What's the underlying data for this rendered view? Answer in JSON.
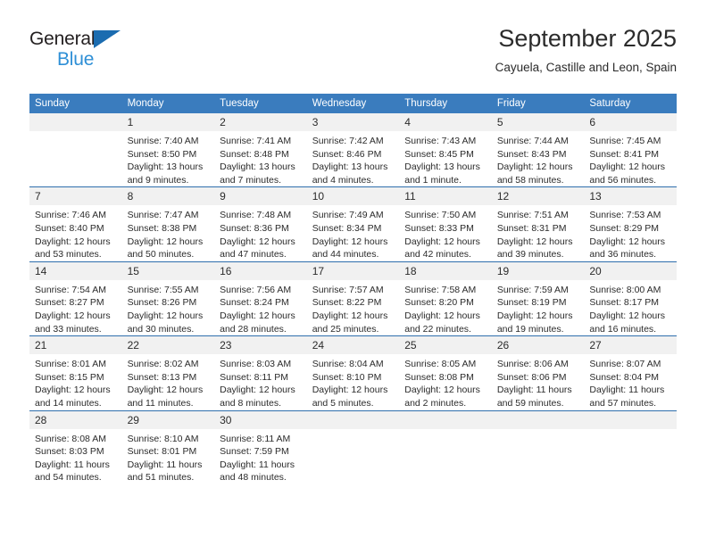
{
  "brand": {
    "name_part1": "General",
    "name_part2": "Blue",
    "triangle_color": "#1b6cb0",
    "blue_text_color": "#2e8fd6"
  },
  "header": {
    "title": "September 2025",
    "subtitle": "Cayuela, Castille and Leon, Spain"
  },
  "theme": {
    "header_row_bg": "#3a7cbe",
    "week_divider": "#2f6fad",
    "daynum_bg": "#f1f1f1",
    "text": "#2b2b2b"
  },
  "calendar": {
    "weekday_headers": [
      "Sunday",
      "Monday",
      "Tuesday",
      "Wednesday",
      "Thursday",
      "Friday",
      "Saturday"
    ],
    "weeks": [
      [
        {
          "day": "",
          "lines": []
        },
        {
          "day": "1",
          "lines": [
            "Sunrise: 7:40 AM",
            "Sunset: 8:50 PM",
            "Daylight: 13 hours",
            "and 9 minutes."
          ]
        },
        {
          "day": "2",
          "lines": [
            "Sunrise: 7:41 AM",
            "Sunset: 8:48 PM",
            "Daylight: 13 hours",
            "and 7 minutes."
          ]
        },
        {
          "day": "3",
          "lines": [
            "Sunrise: 7:42 AM",
            "Sunset: 8:46 PM",
            "Daylight: 13 hours",
            "and 4 minutes."
          ]
        },
        {
          "day": "4",
          "lines": [
            "Sunrise: 7:43 AM",
            "Sunset: 8:45 PM",
            "Daylight: 13 hours",
            "and 1 minute."
          ]
        },
        {
          "day": "5",
          "lines": [
            "Sunrise: 7:44 AM",
            "Sunset: 8:43 PM",
            "Daylight: 12 hours",
            "and 58 minutes."
          ]
        },
        {
          "day": "6",
          "lines": [
            "Sunrise: 7:45 AM",
            "Sunset: 8:41 PM",
            "Daylight: 12 hours",
            "and 56 minutes."
          ]
        }
      ],
      [
        {
          "day": "7",
          "lines": [
            "Sunrise: 7:46 AM",
            "Sunset: 8:40 PM",
            "Daylight: 12 hours",
            "and 53 minutes."
          ]
        },
        {
          "day": "8",
          "lines": [
            "Sunrise: 7:47 AM",
            "Sunset: 8:38 PM",
            "Daylight: 12 hours",
            "and 50 minutes."
          ]
        },
        {
          "day": "9",
          "lines": [
            "Sunrise: 7:48 AM",
            "Sunset: 8:36 PM",
            "Daylight: 12 hours",
            "and 47 minutes."
          ]
        },
        {
          "day": "10",
          "lines": [
            "Sunrise: 7:49 AM",
            "Sunset: 8:34 PM",
            "Daylight: 12 hours",
            "and 44 minutes."
          ]
        },
        {
          "day": "11",
          "lines": [
            "Sunrise: 7:50 AM",
            "Sunset: 8:33 PM",
            "Daylight: 12 hours",
            "and 42 minutes."
          ]
        },
        {
          "day": "12",
          "lines": [
            "Sunrise: 7:51 AM",
            "Sunset: 8:31 PM",
            "Daylight: 12 hours",
            "and 39 minutes."
          ]
        },
        {
          "day": "13",
          "lines": [
            "Sunrise: 7:53 AM",
            "Sunset: 8:29 PM",
            "Daylight: 12 hours",
            "and 36 minutes."
          ]
        }
      ],
      [
        {
          "day": "14",
          "lines": [
            "Sunrise: 7:54 AM",
            "Sunset: 8:27 PM",
            "Daylight: 12 hours",
            "and 33 minutes."
          ]
        },
        {
          "day": "15",
          "lines": [
            "Sunrise: 7:55 AM",
            "Sunset: 8:26 PM",
            "Daylight: 12 hours",
            "and 30 minutes."
          ]
        },
        {
          "day": "16",
          "lines": [
            "Sunrise: 7:56 AM",
            "Sunset: 8:24 PM",
            "Daylight: 12 hours",
            "and 28 minutes."
          ]
        },
        {
          "day": "17",
          "lines": [
            "Sunrise: 7:57 AM",
            "Sunset: 8:22 PM",
            "Daylight: 12 hours",
            "and 25 minutes."
          ]
        },
        {
          "day": "18",
          "lines": [
            "Sunrise: 7:58 AM",
            "Sunset: 8:20 PM",
            "Daylight: 12 hours",
            "and 22 minutes."
          ]
        },
        {
          "day": "19",
          "lines": [
            "Sunrise: 7:59 AM",
            "Sunset: 8:19 PM",
            "Daylight: 12 hours",
            "and 19 minutes."
          ]
        },
        {
          "day": "20",
          "lines": [
            "Sunrise: 8:00 AM",
            "Sunset: 8:17 PM",
            "Daylight: 12 hours",
            "and 16 minutes."
          ]
        }
      ],
      [
        {
          "day": "21",
          "lines": [
            "Sunrise: 8:01 AM",
            "Sunset: 8:15 PM",
            "Daylight: 12 hours",
            "and 14 minutes."
          ]
        },
        {
          "day": "22",
          "lines": [
            "Sunrise: 8:02 AM",
            "Sunset: 8:13 PM",
            "Daylight: 12 hours",
            "and 11 minutes."
          ]
        },
        {
          "day": "23",
          "lines": [
            "Sunrise: 8:03 AM",
            "Sunset: 8:11 PM",
            "Daylight: 12 hours",
            "and 8 minutes."
          ]
        },
        {
          "day": "24",
          "lines": [
            "Sunrise: 8:04 AM",
            "Sunset: 8:10 PM",
            "Daylight: 12 hours",
            "and 5 minutes."
          ]
        },
        {
          "day": "25",
          "lines": [
            "Sunrise: 8:05 AM",
            "Sunset: 8:08 PM",
            "Daylight: 12 hours",
            "and 2 minutes."
          ]
        },
        {
          "day": "26",
          "lines": [
            "Sunrise: 8:06 AM",
            "Sunset: 8:06 PM",
            "Daylight: 11 hours",
            "and 59 minutes."
          ]
        },
        {
          "day": "27",
          "lines": [
            "Sunrise: 8:07 AM",
            "Sunset: 8:04 PM",
            "Daylight: 11 hours",
            "and 57 minutes."
          ]
        }
      ],
      [
        {
          "day": "28",
          "lines": [
            "Sunrise: 8:08 AM",
            "Sunset: 8:03 PM",
            "Daylight: 11 hours",
            "and 54 minutes."
          ]
        },
        {
          "day": "29",
          "lines": [
            "Sunrise: 8:10 AM",
            "Sunset: 8:01 PM",
            "Daylight: 11 hours",
            "and 51 minutes."
          ]
        },
        {
          "day": "30",
          "lines": [
            "Sunrise: 8:11 AM",
            "Sunset: 7:59 PM",
            "Daylight: 11 hours",
            "and 48 minutes."
          ]
        },
        {
          "day": "",
          "lines": []
        },
        {
          "day": "",
          "lines": []
        },
        {
          "day": "",
          "lines": []
        },
        {
          "day": "",
          "lines": []
        }
      ]
    ]
  }
}
